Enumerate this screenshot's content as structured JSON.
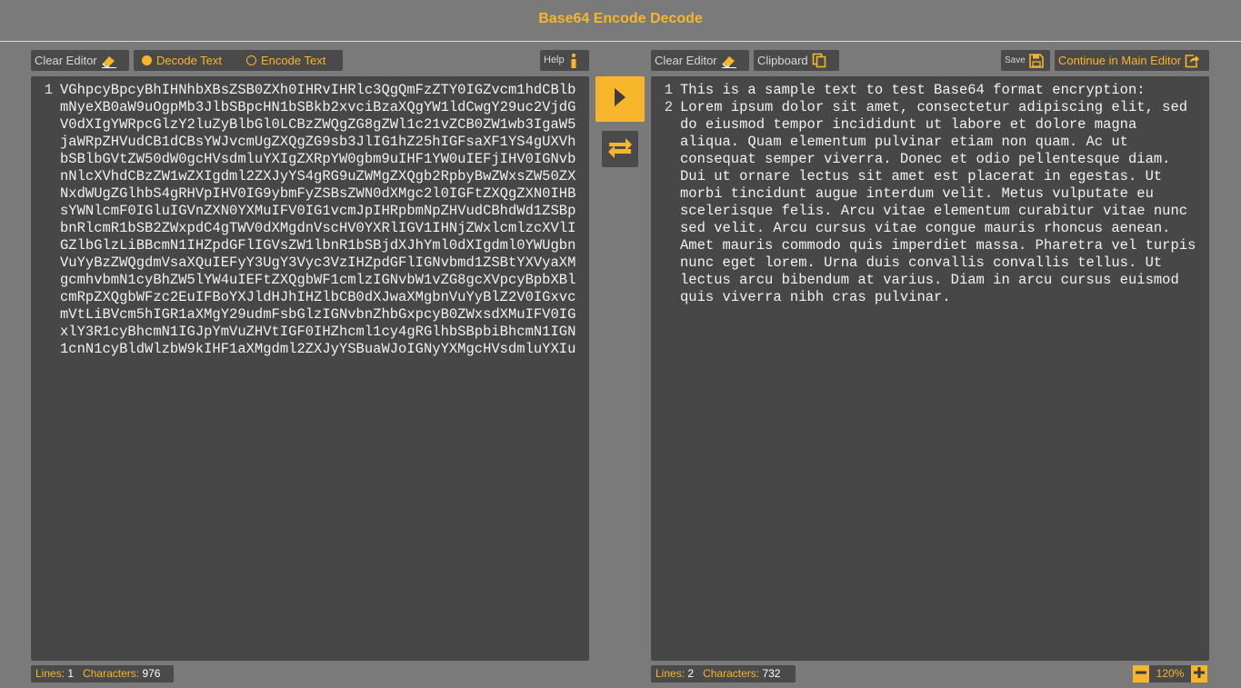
{
  "app": {
    "title": "Base64 Encode Decode"
  },
  "left_toolbar": {
    "clear_label": "Clear Editor",
    "mode_decode_label": "Decode Text",
    "mode_encode_label": "Encode Text",
    "selected_mode": "decode",
    "help_label": "Help"
  },
  "right_toolbar": {
    "clear_label": "Clear Editor",
    "clipboard_label": "Clipboard",
    "save_label": "Save",
    "continue_label": "Continue in Main Editor"
  },
  "left_editor": {
    "lines": [
      {
        "number": "1",
        "text": "VGhpcyBpcyBhIHNhbXBsZSB0ZXh0IHRvIHRlc3QgQmFzZTY0IGZvcm1hdCBlbmNyeXB0aW9uOgpMb3JlbSBpcHN1bSBkb2xvciBzaXQgYW1ldCwgY29uc2VjdGV0dXIgYWRpcGlzY2luZyBlbGl0LCBzZWQgZG8gZWl1c21vZCB0ZW1wb3IgaW5jaWRpZHVudCB1dCBsYWJvcmUgZXQgZG9sb3JlIG1hZ25hIGFsaXF1YS4gUXVhbSBlbGVtZW50dW0gcHVsdmluYXIgZXRpYW0gbm9uIHF1YW0uIEFjIHV0IGNvbnNlcXVhdCBzZW1wZXIgdml2ZXJyYS4gRG9uZWMgZXQgb2RpbyBwZWxsZW50ZXNxdWUgZGlhbS4gRHVpIHV0IG9ybmFyZSBsZWN0dXMgc2l0IGFtZXQgZXN0IHBsYWNlcmF0IGluIGVnZXN0YXMuIFV0IG1vcmJpIHRpbmNpZHVudCBhdWd1ZSBpbnRlcmR1bSB2ZWxpdC4gTWV0dXMgdnVscHV0YXRlIGV1IHNjZWxlcmlzcXVlIGZlbGlzLiBBcmN1IHZpdGFlIGVsZW1lbnR1bSBjdXJhYml0dXIgdml0YWUgbnVuYyBzZWQgdmVsaXQuIEFyY3UgY3Vyc3VzIHZpdGFlIGNvbmd1ZSBtYXVyaXMgcmhvbmN1cyBhZW5lYW4uIEFtZXQgbWF1cmlzIGNvbW1vZG8gcXVpcyBpbXBlcmRpZXQgbWFzc2EuIFBoYXJldHJhIHZlbCB0dXJwaXMgbnVuYyBlZ2V0IGxvcmVtLiBVcm5hIGR1aXMgY29udmFsbGlzIGNvbnZhbGxpcyB0ZWxsdXMuIFV0IGxlY3R1cyBhcmN1IGJpYmVuZHVtIGF0IHZhcml1cy4gRGlhbSBpbiBhcmN1IGN1cnN1cyBldWlzbW9kIHF1aXMgdml2ZXJyYSBuaWJoIGNyYXMgcHVsdmluYXIu"
      }
    ]
  },
  "right_editor": {
    "lines": [
      {
        "number": "1",
        "text": "This is a sample text to test Base64 format encryption:"
      },
      {
        "number": "2",
        "text": "Lorem ipsum dolor sit amet, consectetur adipiscing elit, sed do eiusmod tempor incididunt ut labore et dolore magna aliqua. Quam elementum pulvinar etiam non quam. Ac ut consequat semper viverra. Donec et odio pellentesque diam. Dui ut ornare lectus sit amet est placerat in egestas. Ut morbi tincidunt augue interdum velit. Metus vulputate eu scelerisque felis. Arcu vitae elementum curabitur vitae nunc sed velit. Arcu cursus vitae congue mauris rhoncus aenean. Amet mauris commodo quis imperdiet massa. Pharetra vel turpis nunc eget lorem. Urna duis convallis convallis tellus. Ut lectus arcu bibendum at varius. Diam in arcu cursus euismod quis viverra nibh cras pulvinar."
      }
    ]
  },
  "left_status": {
    "lines_label": "Lines:",
    "lines_value": "1",
    "chars_label": "Characters:",
    "chars_value": "976"
  },
  "right_status": {
    "lines_label": "Lines:",
    "lines_value": "2",
    "chars_label": "Characters:",
    "chars_value": "732"
  },
  "zoom": {
    "value": "120%"
  },
  "icons": {
    "eraser": "eraser-icon",
    "info": "info-icon",
    "clipboard": "clipboard-icon",
    "save": "floppy-disk-icon",
    "export": "export-icon",
    "run": "play-icon",
    "swap": "swap-arrows-icon",
    "minus": "minus-icon",
    "plus": "plus-icon"
  },
  "colors": {
    "accent": "#f7b52c",
    "background": "#7a7a7a",
    "panel": "#474747",
    "control": "#4a4a4a"
  }
}
